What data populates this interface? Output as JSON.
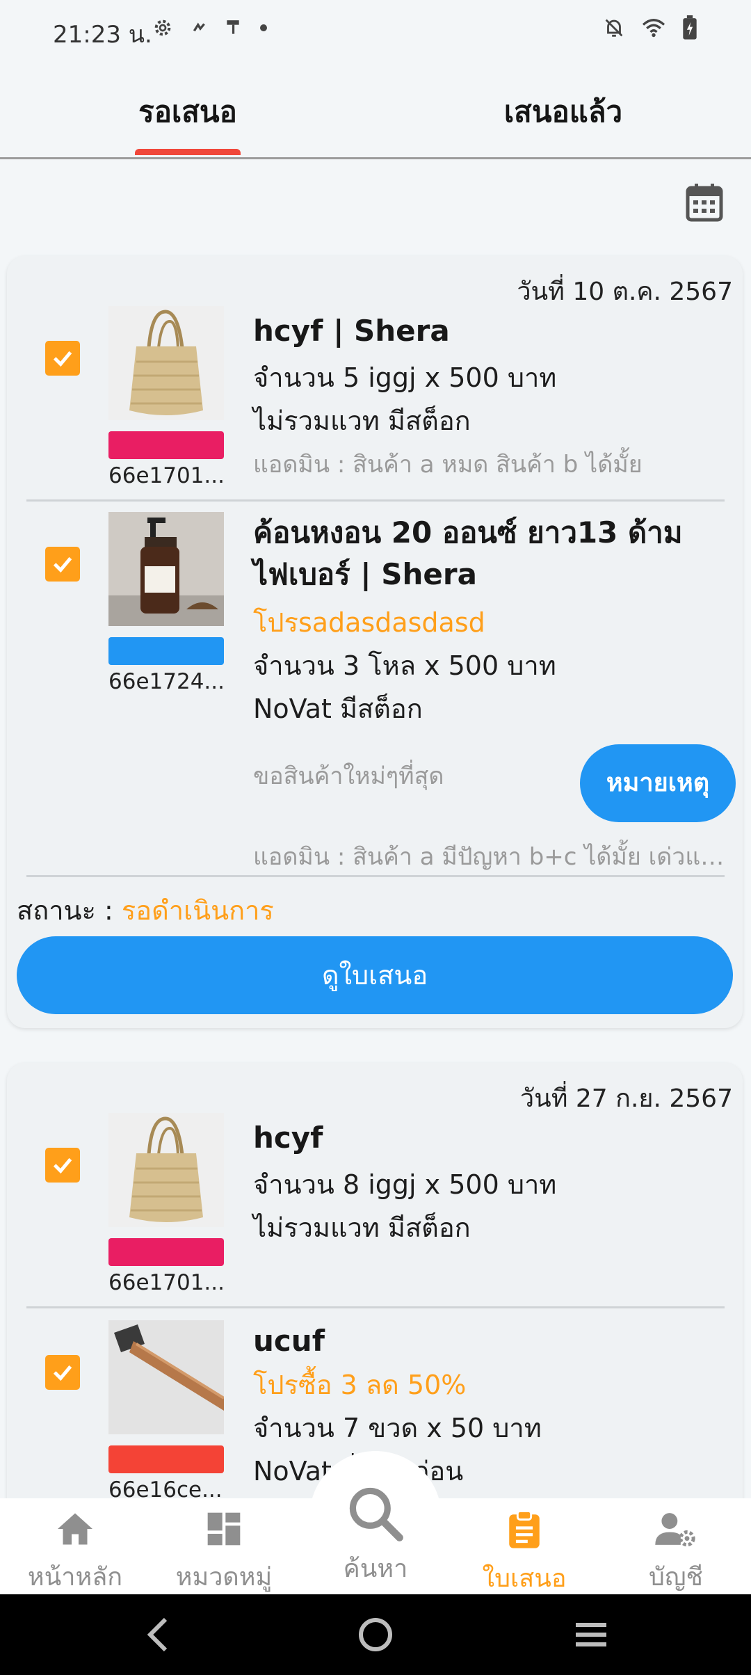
{
  "status_bar": {
    "time": "21:23 น."
  },
  "tabs": [
    {
      "label": "รอเสนอ",
      "active": true
    },
    {
      "label": "เสนอแล้ว",
      "active": false
    }
  ],
  "colors": {
    "accent_orange": "#ff9f1a",
    "primary_blue": "#2196f3",
    "tab_indicator": "#f0473a"
  },
  "quotes": [
    {
      "date": "วันที่ 10 ต.ค. 2567",
      "items": [
        {
          "name": "hcyf | Shera",
          "qty_line": "จำนวน 5 iggj x 500 บาท",
          "vat_stock": "ไม่รวมแวท มีสต็อก",
          "admin_note": "แอดมิน : สินค้า a หมด สินค้า b ได้มั้ย",
          "code": "66e1701...",
          "color_tag": "#e91e63",
          "image": "basket"
        },
        {
          "name": "ค้อนหงอน 20 ออนซ์ ยาว13 ด้ามไฟเบอร์ | Shera",
          "promo": "โปรsadasdasdasd",
          "qty_line": "จำนวน 3 โหล x 500 บาท",
          "vat_stock": "NoVat มีสต็อก",
          "request": "ขอสินค้าใหม่ๆที่สุด",
          "note_button": "หมายเหตุ",
          "admin_note": "แอดมิน : สินค้า a มีปัญหา b+c ได้มั้ย เด่วแถ...",
          "code": "66e1724...",
          "color_tag": "#2196f3",
          "image": "shampoo"
        }
      ],
      "status_label": "สถานะ : ",
      "status_value": "รอดำเนินการ",
      "view_button": "ดูใบเสนอ"
    },
    {
      "date": "วันที่ 27 ก.ย. 2567",
      "items": [
        {
          "name": "hcyf",
          "qty_line": "จำนวน 8 iggj x 500 บาท",
          "vat_stock": "ไม่รวมแวท มีสต็อก",
          "code": "66e1701...",
          "color_tag": "#e91e63",
          "image": "basket"
        },
        {
          "name": "ucuf",
          "promo": "โปรซื้อ 3 ลด 50%",
          "qty_line": "จำนวน 7 ขวด x 50 บาท",
          "vat_stock": "NoVat สั่งจองก่อน",
          "code": "66e16ce...",
          "color_tag": "#f44336",
          "image": "hammer"
        }
      ]
    }
  ],
  "bottom_nav": [
    {
      "label": "หน้าหลัก",
      "icon": "home-icon",
      "active": false
    },
    {
      "label": "หมวดหมู่",
      "icon": "category-icon",
      "active": false
    },
    {
      "label": "ค้นหา",
      "icon": "search-icon",
      "active": false
    },
    {
      "label": "ใบเสนอ",
      "icon": "clipboard-icon",
      "active": true
    },
    {
      "label": "บัญชี",
      "icon": "account-settings-icon",
      "active": false
    }
  ]
}
